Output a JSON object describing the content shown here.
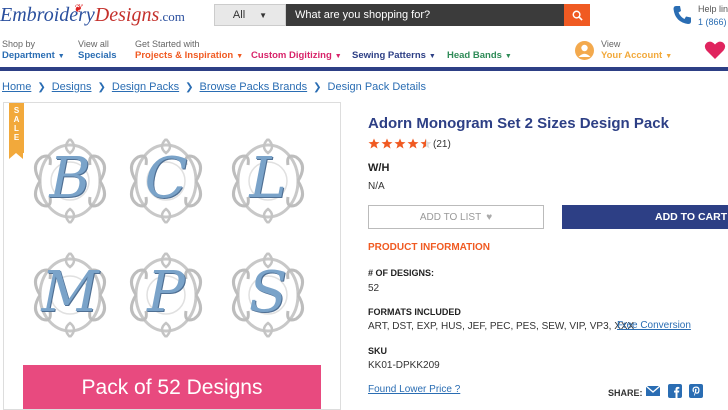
{
  "header": {
    "logo_text_main": "Embroidery",
    "logo_text_accent": "Designs",
    "logo_text_suffix": ".com",
    "search_category": "All",
    "search_placeholder": "What are you shopping for?",
    "helpline_label": "Help line",
    "helpline_number": "1 (866)"
  },
  "nav": {
    "items": [
      {
        "pre": "Shop by",
        "main": "Department",
        "color": "#2a6db3"
      },
      {
        "pre": "View all",
        "main": "Specials",
        "color": "#2a6db3"
      },
      {
        "pre": "Get Started with",
        "main": "Projects & Inspiration",
        "color": "#f05a22"
      },
      {
        "pre": "",
        "main": "Custom Digitizing",
        "color": "#d8246a"
      },
      {
        "pre": "",
        "main": "Sewing Patterns",
        "color": "#2d3f85"
      },
      {
        "pre": "",
        "main": "Head Bands",
        "color": "#2e8b57"
      }
    ],
    "account_pre": "View",
    "account_main": "Your Account"
  },
  "breadcrumb": [
    "Home",
    "Designs",
    "Design Packs",
    "Browse Packs Brands",
    "Design Pack Details"
  ],
  "product": {
    "sale_badge": "SALE",
    "monogram_letters": [
      "B",
      "C",
      "L",
      "M",
      "P",
      "S"
    ],
    "pack_banner": "Pack of 52 Designs",
    "title": "Adorn Monogram Set 2 Sizes Design Pack",
    "rating": 4.5,
    "review_count": "(21)",
    "wh_label": "W/H",
    "wh_value": "N/A",
    "add_to_list": "ADD TO LIST",
    "add_to_cart": "ADD TO CART",
    "info_heading": "PRODUCT INFORMATION",
    "designs_label": "# OF DESIGNS:",
    "designs_value": "52",
    "formats_label": "FORMATS INCLUDED",
    "formats_value": "ART, DST, EXP, HUS, JEF, PEC, PES, SEW, VIP, VP3, XXX",
    "free_conversion": "Free Conversion",
    "sku_label": "SKU",
    "sku_value": "KK01-DPKK209",
    "lower_price": "Found Lower Price ?",
    "share_label": "SHARE:"
  },
  "colors": {
    "brand_navy": "#2d3f85",
    "accent_orange": "#f05a22",
    "link_blue": "#2a6db3",
    "banner_pink": "#e84a7f",
    "monogram_blue": "#7aa3c9"
  }
}
